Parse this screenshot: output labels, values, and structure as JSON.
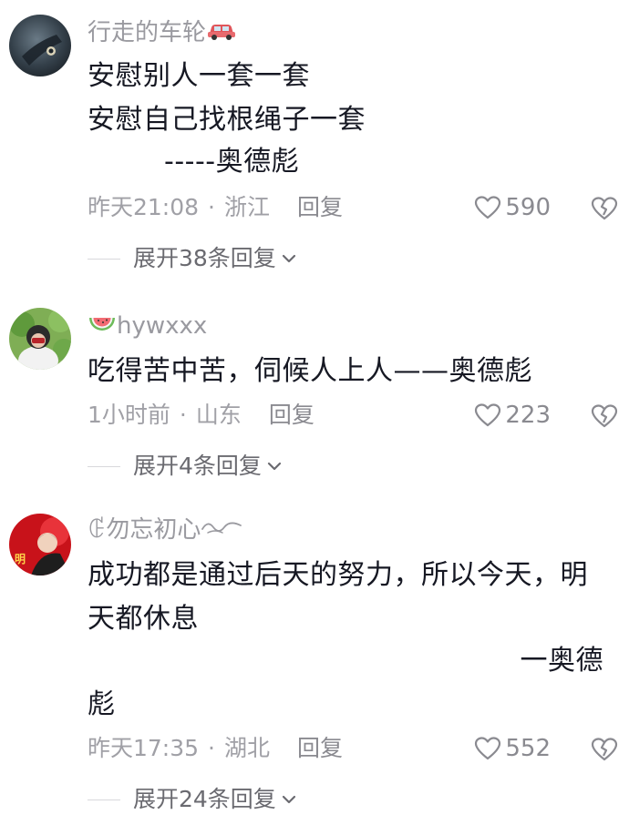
{
  "comments": [
    {
      "username": "行走的车轮",
      "username_emoji": "car-icon",
      "lines": [
        "安慰别人一套一套",
        "安慰自己找根绳子一套",
        "-----奥德彪"
      ],
      "time": "昨天21:08",
      "location": "浙江",
      "reply_label": "回复",
      "likes": "590",
      "expand_label": "展开38条回复"
    },
    {
      "username": "hywxxx",
      "username_emoji": "watermelon-icon",
      "lines": [
        "吃得苦中苦，伺候人上人——奥德彪"
      ],
      "time": "1小时前",
      "location": "山东",
      "reply_label": "回复",
      "likes": "223",
      "expand_label": "展开4条回复"
    },
    {
      "username": "ꂅ勿忘初心",
      "username_emoji": "wave-icon",
      "lines": [
        "成功都是通过后天的努力，所以今天，明",
        "天都休息",
        "一奥德",
        "彪"
      ],
      "time": "昨天17:35",
      "location": "湖北",
      "reply_label": "回复",
      "likes": "552",
      "expand_label": "展开24条回复"
    }
  ],
  "colors": {
    "text": "#161823",
    "muted": "#a0a0a6",
    "like_icon": "#8a8a90"
  },
  "separator": "·"
}
